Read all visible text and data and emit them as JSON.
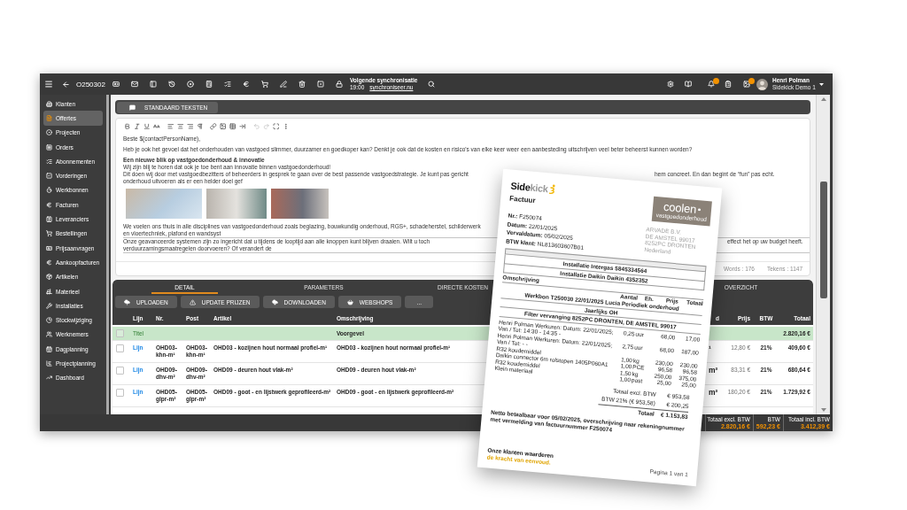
{
  "topbar": {
    "document_number": "O250302",
    "sync_label": "Volgende synchronisatie",
    "sync_time": "19:00",
    "sync_link": "synchroniseer.nu",
    "user_name": "Henri Polman",
    "user_company": "Sidekick Demo 1"
  },
  "sidebar": {
    "items": [
      {
        "label": "Klanten",
        "selected": false
      },
      {
        "label": "Offertes",
        "selected": true
      },
      {
        "label": "Projecten",
        "selected": false
      },
      {
        "label": "Orders",
        "selected": false
      },
      {
        "label": "Abonnementen",
        "selected": false
      },
      {
        "label": "Vorderingen",
        "selected": false
      },
      {
        "label": "Werkbonnen",
        "selected": false
      },
      {
        "label": "Facturen",
        "selected": false
      },
      {
        "label": "Leveranciers",
        "selected": false
      },
      {
        "label": "Bestellingen",
        "selected": false
      },
      {
        "label": "Prijsaanvragen",
        "selected": false
      },
      {
        "label": "Aankoopfacturen",
        "selected": false
      },
      {
        "label": "Artikelen",
        "selected": false
      },
      {
        "label": "Materieel",
        "selected": false
      },
      {
        "label": "Installaties",
        "selected": false
      },
      {
        "label": "Stockwijziging",
        "selected": false
      },
      {
        "label": "Werknemers",
        "selected": false
      },
      {
        "label": "Dagplanning",
        "selected": false
      },
      {
        "label": "Projectplanning",
        "selected": false
      },
      {
        "label": "Dashboard",
        "selected": false
      }
    ]
  },
  "standard_texts": {
    "button": "STANDAARD TEKSTEN"
  },
  "editor": {
    "toolbar": {
      "undo": {
        "disabled": true
      },
      "redo": {
        "disabled": true
      }
    },
    "paragraphs": [
      {
        "kind": "plain",
        "lines": [
          {
            "text": "Beste $(contactPersonName),"
          }
        ]
      },
      {
        "kind": "plain",
        "lines": [
          {
            "text": "Heb je ook het gevoel dat het onderhouden van vastgoed slimmer, duurzamer en goedkoper kan? Denkt je ook dat de kosten en risico's van elke keer weer een aanbesteding uitschrijven veel beter beheerst kunnen worden?"
          }
        ]
      },
      {
        "kind": "section",
        "heading": "Een nieuwe blik op vastgoedonderhoud & innovatie",
        "lines": [
          {
            "text": "Wij zijn blij te horen dat ook je toe bent aan innovatie binnen vastgoedonderhoud!"
          },
          {
            "text": "Dit doen wij door met vastgoedbezitters of beheerders in gesprek te gaan over de best passende vastgoedstrategie. Je kunt pas gericht onderhoud uitvoeren als er een helder doel gef",
            "continuation": "hem concreet. En dan begint de “fun” pas echt."
          }
        ]
      },
      {
        "kind": "photos"
      },
      {
        "kind": "ruled",
        "lines": [
          {
            "text": "We voelen ons thuis in alle disciplines van vastgoedonderhoud zoals beglazing, bouwkundig onderhoud, RGS+, schadeherstel, schilderwerk en vloertechniek, plafond en wandsyst"
          },
          {
            "text": "Onze geavanceerde systemen zijn zo ingericht dat u tijdens de looptijd aan alle knoppen kunt blijven draaien. Wilt u toch verduurzamingsmaatregelen doorvoeren? Of verandert de",
            "continuation": "effect het op uw budget heeft."
          }
        ]
      }
    ],
    "words": "Words : 176",
    "characters": "Tekens : 1147"
  },
  "table": {
    "tabs": [
      {
        "label": "DETAIL",
        "selected": true
      },
      {
        "label": "PARAMETERS",
        "selected": false
      },
      {
        "label": "DIRECTE KOSTEN",
        "selected": false
      },
      {
        "label": "OVERZICHT",
        "selected": false
      }
    ],
    "buttons": [
      "UPLOADEN",
      "UPDATE PRIJZEN",
      "DOWNLOADEN",
      "WEBSHOPS",
      "..."
    ],
    "columns": [
      "Lijn",
      "Nr.",
      "Post",
      "Artikel",
      "Omschrijving",
      "d",
      "Prijs",
      "BTW",
      "Totaal"
    ],
    "rows": [
      {
        "kind": "title",
        "checked": false,
        "lijn": "Titel",
        "omschrijving": "Voorgevel",
        "totaal": "2.820,16 €"
      },
      {
        "kind": "line",
        "checked": false,
        "lijn": "Lijn",
        "nr": "OHD03-khn-m¹",
        "post": "OHD03-khn-m¹",
        "artikel": "OHD03 - kozijnen hout normaal profiel-m¹",
        "omschrijving": "OHD03 - kozijnen hout normaal profiel-m¹",
        "column_7": "¹",
        "prijs": "12,80 €",
        "btw": "21%",
        "totaal": "409,60 €"
      },
      {
        "kind": "line",
        "checked": false,
        "lijn": "Lijn",
        "nr": "OHD09-dhv-m²",
        "post": "OHD09-dhv-m²",
        "artikel": "OHD09 - deuren hout vlak-m²",
        "omschrijving": "OHD09 - deuren hout vlak-m²",
        "column_7": "m²",
        "prijs": "83,31 €",
        "btw": "21%",
        "totaal": "680,64 €"
      },
      {
        "kind": "line",
        "checked": false,
        "lijn": "Lijn",
        "nr": "OHD05-glpr-m²",
        "post": "OHD05-glpr-m²",
        "artikel": "OHD09 - goot - en lijstwerk geprofileerd-m²",
        "omschrijving": "OHD09 - goot - en lijstwerk geprofileerd-m²",
        "column_7": "m²",
        "prijs": "180,20 €",
        "btw": "21%",
        "totaal": "1.729,92 €"
      }
    ]
  },
  "footer": {
    "totals": [
      {
        "label": "Totaal excl. BTW",
        "value": "2.820,16 €"
      },
      {
        "label": "BTW",
        "value": "592,23 €"
      },
      {
        "label": "Totaal incl. BTW",
        "value": "3.412,39 €"
      }
    ]
  },
  "invoice": {
    "logo": "**Side**kick",
    "title": "Factuur",
    "company_logo": {
      "name": "coolen",
      "tagline": "vastgoedonderhoud"
    },
    "fields": [
      {
        "label": "Nr.:",
        "value": "F250074"
      },
      {
        "label": "Datum:",
        "value": "22/01/2025"
      },
      {
        "label": "Vervaldatum:",
        "value": "05/02/2025"
      },
      {
        "label": "BTW klant:",
        "value": "NL813603607B01"
      }
    ],
    "address": [
      "ARVADE B.V.",
      "DE AMSTEL 99017",
      "8252PC DRONTEN",
      "Nederland"
    ],
    "sections": [
      "Installatie Intergas  5845334564",
      "Installatie Daikin Daikin 4352352"
    ],
    "description_header": "Omschrijving",
    "columns": [
      "Aantal",
      "Eh.",
      "Prijs",
      "Totaal"
    ],
    "work_order": "Werkbon T250030 22/01/2025 Lucia Periodiek onderhoud",
    "work_order_note": "Jaarlijks OH",
    "task": "Filter vervanging 8252PC DRONTEN, DE AMSTEL 99017",
    "items": [
      {
        "description": "Henri Polman Werkuren: Datum: 22/01/2025; Van / Tot: 14:30 - 14:35 -",
        "quantity": "0,25",
        "unit": "uur",
        "price": "68,00",
        "total": "17,00"
      },
      {
        "description": "Henri Polman Werkuren: Datum: 22/01/2025; Van / Tot: - -",
        "quantity": "2,75",
        "unit": "uur",
        "price": "68,00",
        "total": "187,00"
      },
      {
        "description": "R32 koudemiddel",
        "quantity": "1,00",
        "unit": "kg",
        "price": "230,00",
        "total": "230,00"
      },
      {
        "description": "Daikin connector 6m rolstopen 1405P060A1",
        "quantity": "1,00",
        "unit": "PCE",
        "price": "96,58",
        "total": "96,58"
      },
      {
        "description": "R32 koudemiddel",
        "quantity": "1,50",
        "unit": "kg",
        "price": "250,00",
        "total": "375,00"
      },
      {
        "description": "Klein materiaal",
        "quantity": "1,00",
        "unit": "post",
        "price": "25,00",
        "total": "25,00"
      }
    ],
    "totals": [
      {
        "label": "Totaal excl. BTW",
        "value": "€ 953,58"
      },
      {
        "label": "BTW 21% (€ 953,58)",
        "value": "€ 200,25"
      },
      {
        "label": "Totaal",
        "value": "€ 1.153,83"
      }
    ],
    "payment_note": "Netto betaalbaar voor 05/02/2025, overschrijving naar rekeningnummer met vermelding van factuurnummer F250074",
    "slogan": "Onze klanten waarderen",
    "slogan_accent": "de kracht van eenvoud.",
    "page": "Pagina 1 van 1"
  }
}
